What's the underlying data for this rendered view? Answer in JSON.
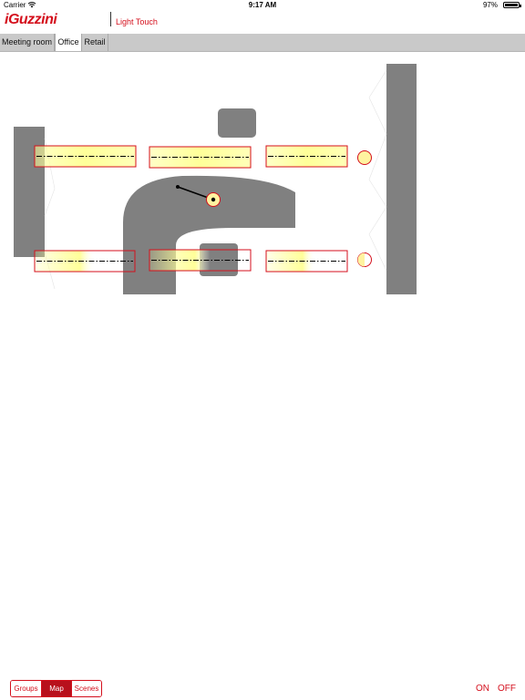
{
  "status_bar": {
    "carrier": "Carrier",
    "wifi_icon": "wifi-icon",
    "time": "9:17 AM",
    "battery_percent": "97%",
    "battery_level": 0.97
  },
  "header": {
    "logo": "iGuzzini",
    "title": "Light Touch"
  },
  "tabs": [
    {
      "label": "Meeting room",
      "active": false
    },
    {
      "label": "Office",
      "active": true
    },
    {
      "label": "Retail",
      "active": false
    }
  ],
  "floor_map": {
    "fixtures": [
      {
        "type": "linear",
        "row": "top",
        "column": 1
      },
      {
        "type": "linear",
        "row": "top",
        "column": 2
      },
      {
        "type": "linear",
        "row": "top",
        "column": 3
      },
      {
        "type": "spot",
        "row": "top",
        "column": 4
      },
      {
        "type": "spot",
        "row": "center",
        "column": 2
      },
      {
        "type": "linear",
        "row": "bottom",
        "column": 1
      },
      {
        "type": "linear",
        "row": "bottom",
        "column": 2
      },
      {
        "type": "linear",
        "row": "bottom",
        "column": 3
      },
      {
        "type": "spot",
        "row": "bottom",
        "column": 4
      }
    ],
    "colors": {
      "wall": "#808080",
      "fixture_border": "#d40f1c",
      "light_glow": "#ffff99",
      "spot_fill": "#fff3a0"
    }
  },
  "bottom_bar": {
    "view_modes": [
      {
        "label": "Groups",
        "active": false
      },
      {
        "label": "Map",
        "active": true
      },
      {
        "label": "Scenes",
        "active": false
      }
    ],
    "on_label": "ON",
    "off_label": "OFF"
  },
  "colors": {
    "accent": "#d40f1c",
    "tabbar_bg": "#c9c9c9"
  }
}
